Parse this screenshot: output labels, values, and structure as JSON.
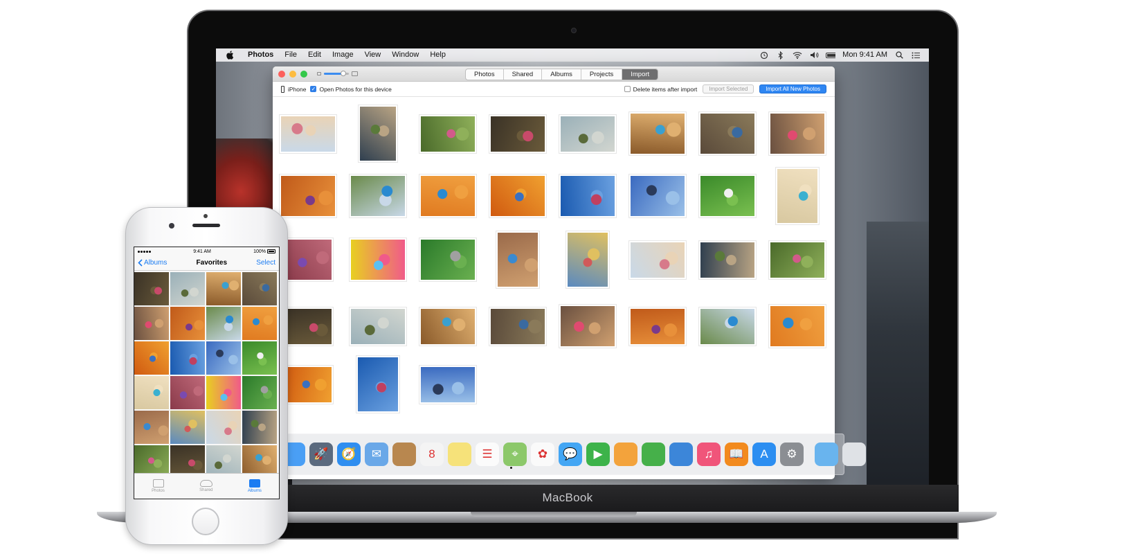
{
  "mac": {
    "brand": "MacBook",
    "menubar": {
      "app": "Photos",
      "menus": [
        "File",
        "Edit",
        "Image",
        "View",
        "Window",
        "Help"
      ],
      "clock": "Mon 9:41 AM",
      "status_icons": [
        "time-machine-icon",
        "bluetooth-icon",
        "wifi-icon",
        "volume-icon",
        "battery-icon",
        "spotlight-icon",
        "notification-center-icon"
      ]
    },
    "photos_window": {
      "tabs": [
        {
          "label": "Photos",
          "active": false
        },
        {
          "label": "Shared",
          "active": false
        },
        {
          "label": "Albums",
          "active": false
        },
        {
          "label": "Projects",
          "active": false
        },
        {
          "label": "Import",
          "active": true
        }
      ],
      "device_label": "iPhone",
      "open_photos_label": "Open Photos for this device",
      "open_photos_checked": true,
      "delete_after_label": "Delete items after import",
      "delete_after_checked": false,
      "import_selected_label": "Import Selected",
      "import_all_label": "Import All New Photos",
      "thumbnail_count": 35
    },
    "dock": {
      "apps": [
        {
          "name": "finder-icon",
          "color": "#4a9ff5"
        },
        {
          "name": "launchpad-icon",
          "color": "#5b6a7e"
        },
        {
          "name": "safari-icon",
          "color": "#2f8ef0"
        },
        {
          "name": "mail-icon",
          "color": "#6aa8e8"
        },
        {
          "name": "contacts-icon",
          "color": "#b8874f"
        },
        {
          "name": "calendar-icon",
          "color": "#f4f4f4"
        },
        {
          "name": "notes-icon",
          "color": "#f6e27a"
        },
        {
          "name": "reminders-icon",
          "color": "#fbfbfb"
        },
        {
          "name": "maps-icon",
          "color": "#8cc86a"
        },
        {
          "name": "photos-icon",
          "color": "#fafafa"
        },
        {
          "name": "messages-icon",
          "color": "#43a6f4"
        },
        {
          "name": "facetime-icon",
          "color": "#3db34a"
        },
        {
          "name": "pages-icon",
          "color": "#f3a33c"
        },
        {
          "name": "numbers-icon",
          "color": "#46b04a"
        },
        {
          "name": "keynote-icon",
          "color": "#3c86d9"
        },
        {
          "name": "itunes-icon",
          "color": "#f0557a"
        },
        {
          "name": "ibooks-icon",
          "color": "#f28a1e"
        },
        {
          "name": "app-store-icon",
          "color": "#2c8ef1"
        },
        {
          "name": "system-preferences-icon",
          "color": "#8b8e93"
        },
        {
          "name": "downloads-folder-icon",
          "color": "#69b4ee"
        },
        {
          "name": "trash-icon",
          "color": "#dfe2e6"
        }
      ]
    }
  },
  "iphone": {
    "status": {
      "time": "9:41 AM",
      "battery": "100%"
    },
    "nav": {
      "back": "Albums",
      "title": "Favorites",
      "action": "Select"
    },
    "tabs": [
      {
        "label": "Photos",
        "active": false
      },
      {
        "label": "Shared",
        "active": false
      },
      {
        "label": "Albums",
        "active": true
      }
    ],
    "thumbnail_count": 24
  },
  "colors": {
    "accent_blue": "#2f86f2",
    "ios_blue": "#1b7cf2",
    "active_tab": "#6f6f70"
  }
}
